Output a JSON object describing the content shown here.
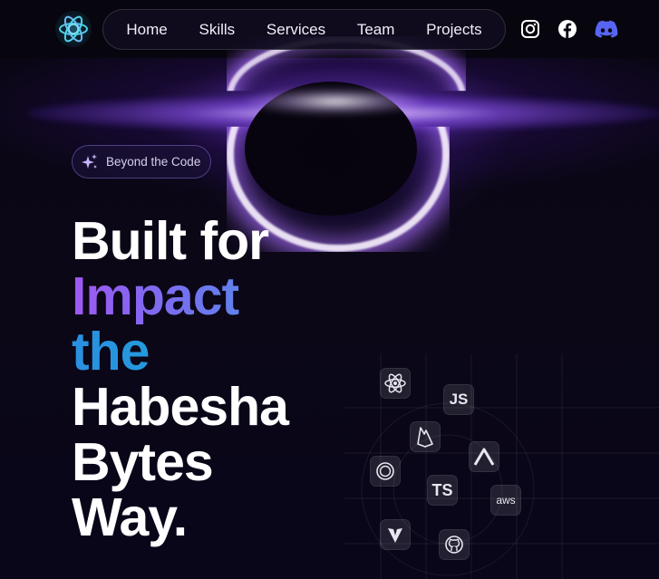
{
  "nav": {
    "logo_icon": "atom-logo-icon",
    "links": [
      {
        "label": "Home"
      },
      {
        "label": "Skills"
      },
      {
        "label": "Services"
      },
      {
        "label": "Team"
      },
      {
        "label": "Projects"
      }
    ],
    "socials": [
      {
        "icon": "instagram-icon"
      },
      {
        "icon": "facebook-icon"
      },
      {
        "icon": "discord-icon",
        "color": "#5865F2"
      }
    ]
  },
  "hero": {
    "badge": {
      "icon": "sparkles-icon",
      "label": "Beyond the Code"
    },
    "headline": {
      "line1": "Built for",
      "line2": "Impact",
      "line3": "the",
      "line4": "Habesha",
      "line5": "Bytes",
      "line6": "Way."
    }
  },
  "tech_icons": [
    {
      "icon": "react-icon"
    },
    {
      "icon": "javascript-icon",
      "label": "JS"
    },
    {
      "icon": "firebase-icon"
    },
    {
      "icon": "arch-icon"
    },
    {
      "icon": "openai-icon"
    },
    {
      "icon": "typescript-icon",
      "label": "TS"
    },
    {
      "icon": "aws-icon",
      "label": "aws"
    },
    {
      "icon": "vite-icon"
    },
    {
      "icon": "github-icon"
    }
  ],
  "colors": {
    "background": "#0a0614",
    "accent_purple": "#9f58f2",
    "accent_blue": "#1aaed8",
    "text": "#ffffff"
  }
}
